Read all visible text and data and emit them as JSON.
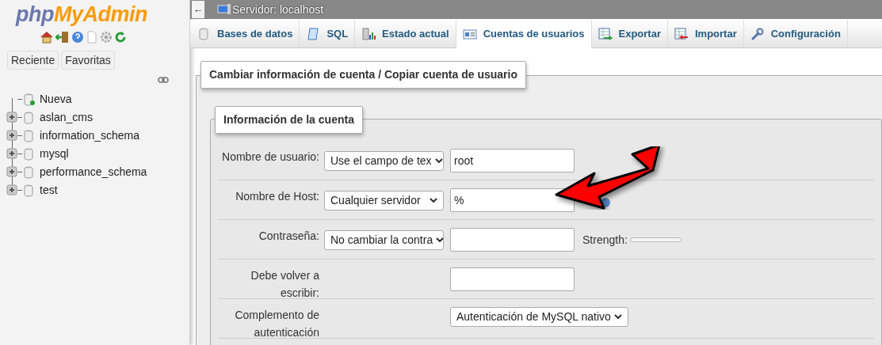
{
  "sidebar": {
    "logo": [
      "php",
      "MyAdmin"
    ],
    "buttons": [
      "Reciente",
      "Favoritas"
    ],
    "tree": [
      {
        "label": "Nueva",
        "kind": "new"
      },
      {
        "label": "aslan_cms",
        "kind": "db",
        "expanded": false
      },
      {
        "label": "information_schema",
        "kind": "db",
        "expanded": false
      },
      {
        "label": "mysql",
        "kind": "db",
        "expanded": false
      },
      {
        "label": "performance_schema",
        "kind": "db",
        "expanded": false
      },
      {
        "label": "test",
        "kind": "db",
        "expanded": false
      }
    ]
  },
  "topbar": {
    "back": "←",
    "title": "Servidor: localhost"
  },
  "tabs": [
    {
      "label": "Bases de datos",
      "selected": false
    },
    {
      "label": "SQL",
      "selected": false
    },
    {
      "label": "Estado actual",
      "selected": false
    },
    {
      "label": "Cuentas de usuarios",
      "selected": true
    },
    {
      "label": "Exportar",
      "selected": false
    },
    {
      "label": "Importar",
      "selected": false
    },
    {
      "label": "Configuración",
      "selected": false
    }
  ],
  "form": {
    "title": "Cambiar información de cuenta / Copiar cuenta de usuario",
    "section": "Información de la cuenta",
    "rows": [
      {
        "label": "Nombre de usuario:",
        "select": "Use el campo de tex",
        "value": "root"
      },
      {
        "label": "Nombre de Host:",
        "select": "Cualquier servidor",
        "value": "%",
        "help": true
      },
      {
        "label": "Contraseña:",
        "select": "No cambiar la contra",
        "value": "",
        "strength": {
          "label": "Strength:",
          "level": 0
        }
      },
      {
        "label": "Debe volver a escribir:",
        "value": ""
      },
      {
        "label": "Complemento de autenticación",
        "wide_select": "Autenticación de MySQL nativo"
      }
    ]
  }
}
